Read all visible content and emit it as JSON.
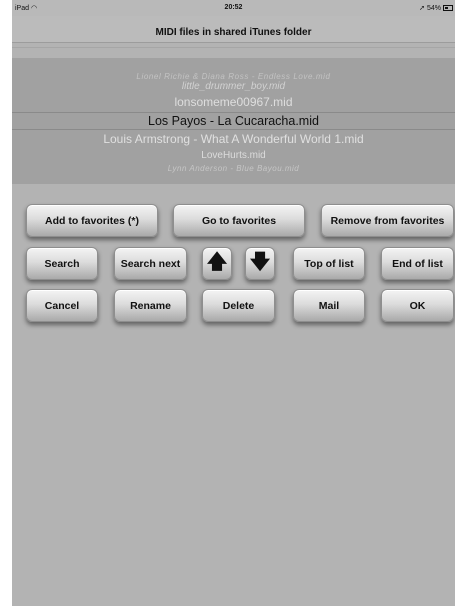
{
  "status_bar": {
    "device": "iPad",
    "wifi_icon": "wifi-icon",
    "time": "20:52",
    "location_icon": "location-arrow-icon",
    "battery_percent": "54%",
    "battery_level": 0.54
  },
  "title": "MIDI files in shared iTunes folder",
  "picker": {
    "items": [
      "Lionel Richie & Diana Ross - Endless Love.mid",
      "little_drummer_boy.mid",
      "lonsomeme00967.mid",
      "Los Payos - La Cucaracha.mid",
      "Louis Armstrong - What A Wonderful World 1.mid",
      "LoveHurts.mid",
      "Lynn Anderson - Blue Bayou.mid"
    ],
    "selected_index": 3
  },
  "buttons": {
    "add_to_favorites": "Add to favorites (*)",
    "go_to_favorites": "Go to favorites",
    "remove_from_favorites": "Remove from favorites",
    "search": "Search",
    "search_next": "Search next",
    "up": "🡅",
    "down": "🡇",
    "top_of_list": "Top of list",
    "end_of_list": "End of list",
    "cancel": "Cancel",
    "rename": "Rename",
    "delete": "Delete",
    "mail": "Mail",
    "ok": "OK"
  }
}
